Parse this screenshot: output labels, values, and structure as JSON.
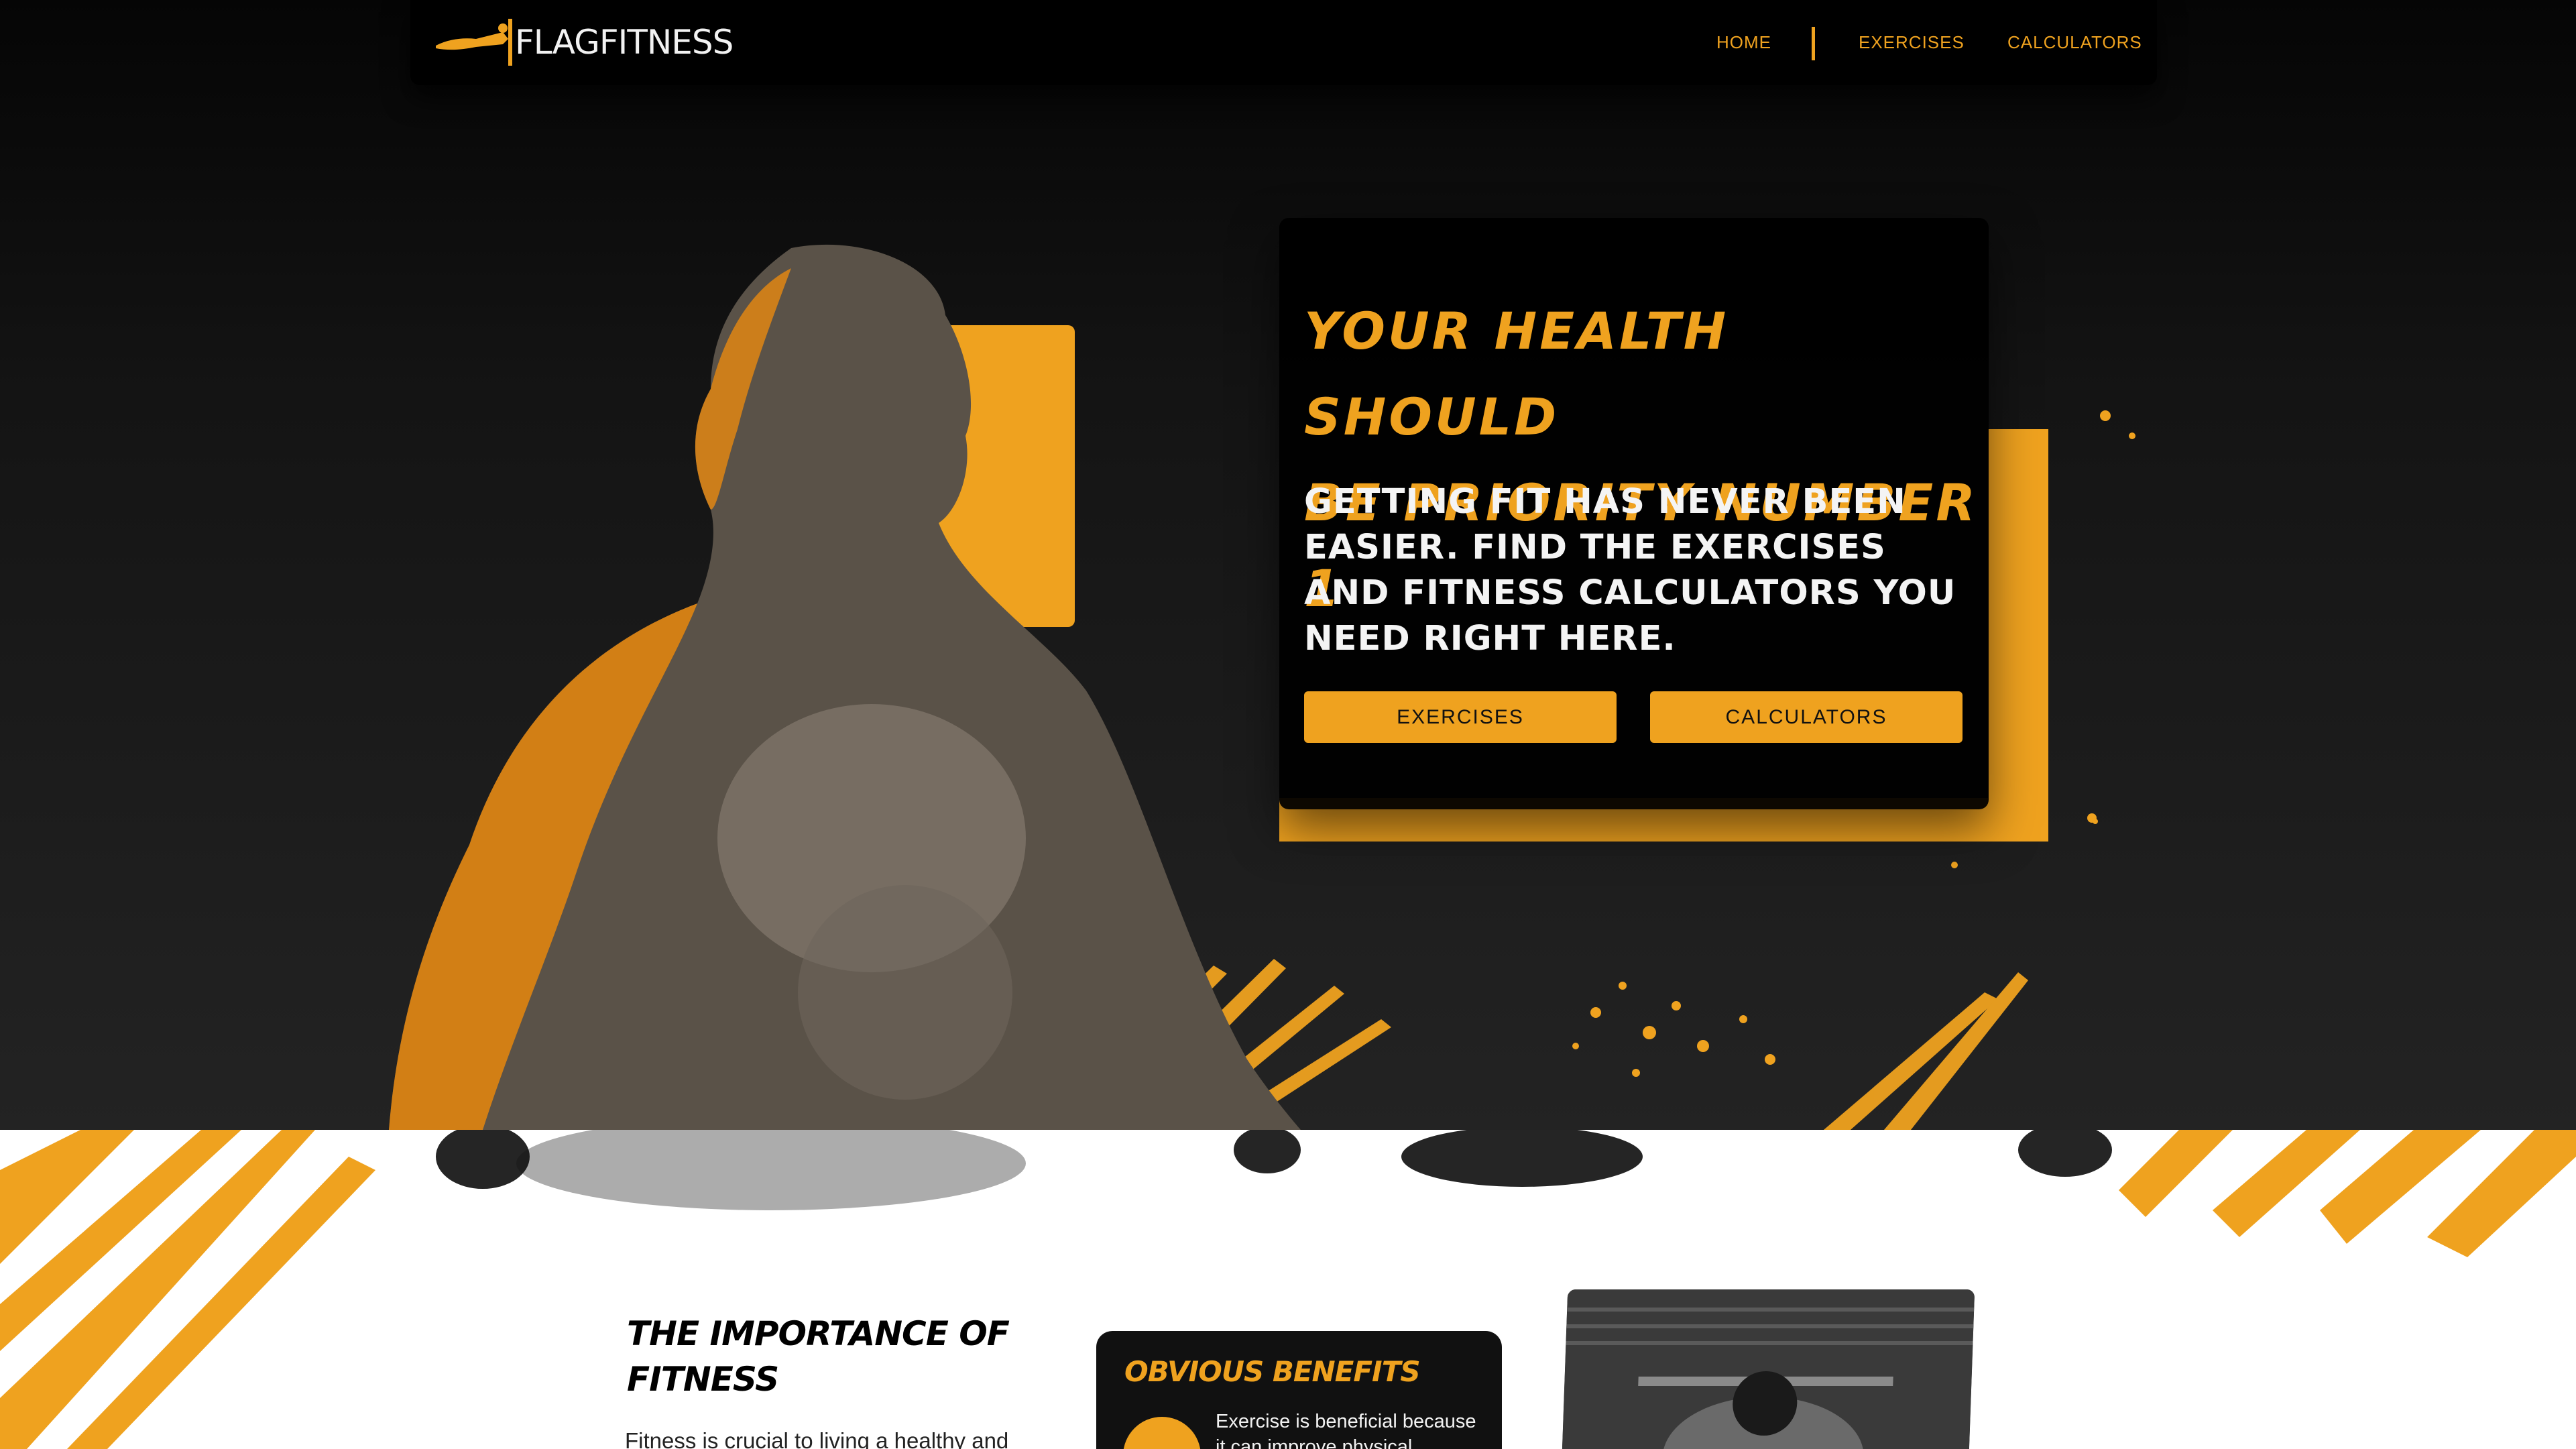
{
  "nav": {
    "brand": "FLAGFITNESS",
    "links": [
      "HOME",
      "EXERCISES",
      "CALCULATORS"
    ]
  },
  "hero": {
    "title_line1": "YOUR HEALTH SHOULD",
    "title_line2": "BE PRIORITY NUMBER 1",
    "subtitle": "GETTING FIT HAS NEVER BEEN EASIER. FIND THE EXERCISES AND FITNESS CALCULATORS YOU NEED RIGHT HERE.",
    "buttons": [
      "EXERCISES",
      "CALCULATORS"
    ]
  },
  "importance": {
    "title": "THE IMPORTANCE OF FITNESS",
    "body": "Fitness is crucial to living a healthy and"
  },
  "benefits": {
    "title": "OBVIOUS BENEFITS",
    "text": "Exercise is beneficial because it can improve physical"
  },
  "colors": {
    "accent": "#efa21f",
    "nav_bg": "#000000",
    "hero_bg": "#232323",
    "section_bg": "#ffffff"
  },
  "icons": {
    "logo": "flag-athlete-logo",
    "benefit": "benefit-icon"
  }
}
